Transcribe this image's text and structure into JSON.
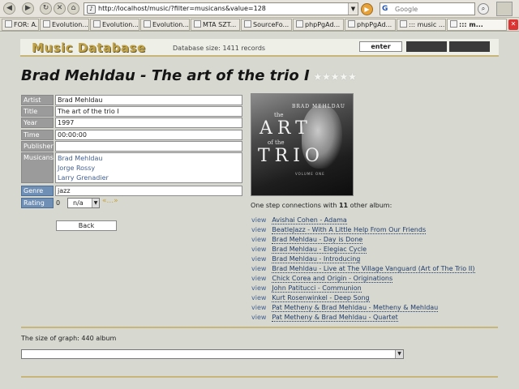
{
  "browser": {
    "url": "http://localhost/music/?filter=musicans&value=128",
    "search_placeholder": "Google",
    "tabs": [
      {
        "label": "FOR: A..."
      },
      {
        "label": "Evolution..."
      },
      {
        "label": "Evolution..."
      },
      {
        "label": "Evolution..."
      },
      {
        "label": "MTA SZT..."
      },
      {
        "label": "SourceFo..."
      },
      {
        "label": "phpPgAd..."
      },
      {
        "label": "phpPgAd..."
      },
      {
        "label": "::: music ..."
      },
      {
        "label": "::: m..."
      }
    ]
  },
  "header": {
    "logo": "Music Database",
    "db_size": "Database size: 1411 records",
    "enter_label": "enter"
  },
  "album": {
    "title": "Brad Mehldau - The art of the trio I",
    "fields": {
      "artist_label": "Artist",
      "artist": "Brad Mehldau",
      "title_label": "Title",
      "title": "The art of the trio I",
      "year_label": "Year",
      "year": "1997",
      "time_label": "Time",
      "time": "00:00:00",
      "publisher_label": "Publisher",
      "publisher": "",
      "musicians_label": "Musicans",
      "musicians": [
        "Brad Mehldau",
        "Jorge Rossy",
        "Larry Grenadier"
      ],
      "genre_label": "Genre",
      "genre": "jazz",
      "rating_label": "Rating",
      "rating_value": "0",
      "rating_selected": "n/a",
      "rating_go": "«...»"
    },
    "back_label": "Back",
    "cover": {
      "artist": "BRAD MEHLDAU",
      "line1": "the",
      "line2": "ART",
      "line3": "of the",
      "line4": "TRIO",
      "line5": "VOLUME ONE"
    }
  },
  "connections": {
    "prefix": "One step connections with ",
    "count": "11",
    "suffix": " other album:",
    "view_label": "view",
    "albums": [
      "Avishai Cohen - Adama",
      "BeatleJazz - With A Little Help From Our Friends",
      "Brad Mehldau - Day is Done",
      "Brad Mehldau - Elegiac Cycle",
      "Brad Mehldau - Introducing",
      "Brad Mehldau - Live at The Village Vanguard (Art of The Trio II)",
      "Chick Corea and Origin - Originations",
      "John Patitucci - Communion",
      "Kurt Rosenwinkel - Deep Song",
      "Pat Metheny & Brad Mehldau - Metheny & Mehldau",
      "Pat Metheny & Brad Mehldau - Quartet"
    ]
  },
  "graph": {
    "size_text": "The size of graph: 440 album"
  }
}
